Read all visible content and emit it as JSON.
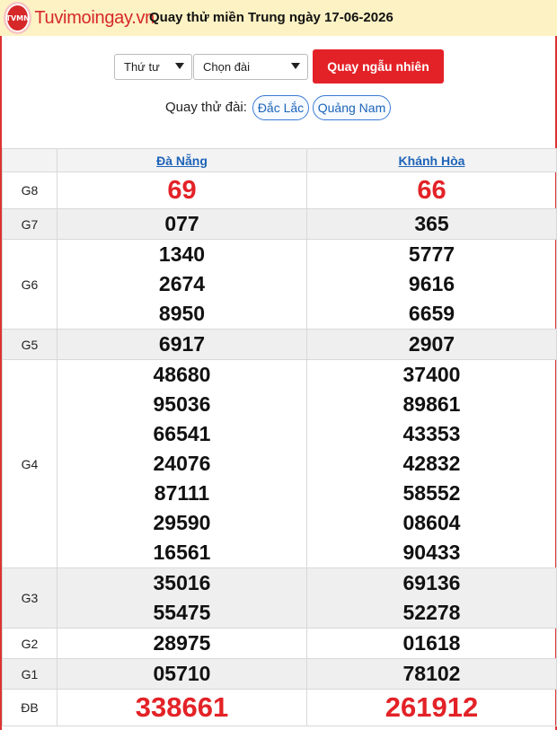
{
  "header": {
    "logo_text": "Tuvimoingay.vn",
    "logo_badge": "TVMN",
    "title": "Quay thử miền Trung ngày 17-06-2026"
  },
  "controls": {
    "day_select": "Thứ tư",
    "station_select": "Chọn đài",
    "spin_button": "Quay ngẫu nhiên"
  },
  "quick_spin": {
    "label": "Quay thử đài:",
    "stations": [
      "Đắc Lắc",
      "Quảng Nam"
    ]
  },
  "results": {
    "columns": [
      "Đà Nẵng",
      "Khánh Hòa"
    ],
    "prizes": [
      {
        "label": "G8",
        "red": true,
        "alt": false,
        "values": [
          [
            "69"
          ],
          [
            "66"
          ]
        ]
      },
      {
        "label": "G7",
        "red": false,
        "alt": true,
        "values": [
          [
            "077"
          ],
          [
            "365"
          ]
        ]
      },
      {
        "label": "G6",
        "red": false,
        "alt": false,
        "values": [
          [
            "1340",
            "2674",
            "8950"
          ],
          [
            "5777",
            "9616",
            "6659"
          ]
        ]
      },
      {
        "label": "G5",
        "red": false,
        "alt": true,
        "values": [
          [
            "6917"
          ],
          [
            "2907"
          ]
        ]
      },
      {
        "label": "G4",
        "red": false,
        "alt": false,
        "values": [
          [
            "48680",
            "95036",
            "66541",
            "24076",
            "87111",
            "29590",
            "16561"
          ],
          [
            "37400",
            "89861",
            "43353",
            "42832",
            "58552",
            "08604",
            "90433"
          ]
        ]
      },
      {
        "label": "G3",
        "red": false,
        "alt": true,
        "values": [
          [
            "35016",
            "55475"
          ],
          [
            "69136",
            "52278"
          ]
        ]
      },
      {
        "label": "G2",
        "red": false,
        "alt": false,
        "values": [
          [
            "28975"
          ],
          [
            "01618"
          ]
        ]
      },
      {
        "label": "G1",
        "red": false,
        "alt": true,
        "values": [
          [
            "05710"
          ],
          [
            "78102"
          ]
        ]
      },
      {
        "label": "ĐB",
        "red": true,
        "alt": false,
        "values": [
          [
            "338661"
          ],
          [
            "261912"
          ]
        ]
      }
    ]
  },
  "colors": {
    "accent_red": "#e32227",
    "link_blue": "#1d63b8",
    "topbar_bg": "#fdf2c4"
  }
}
